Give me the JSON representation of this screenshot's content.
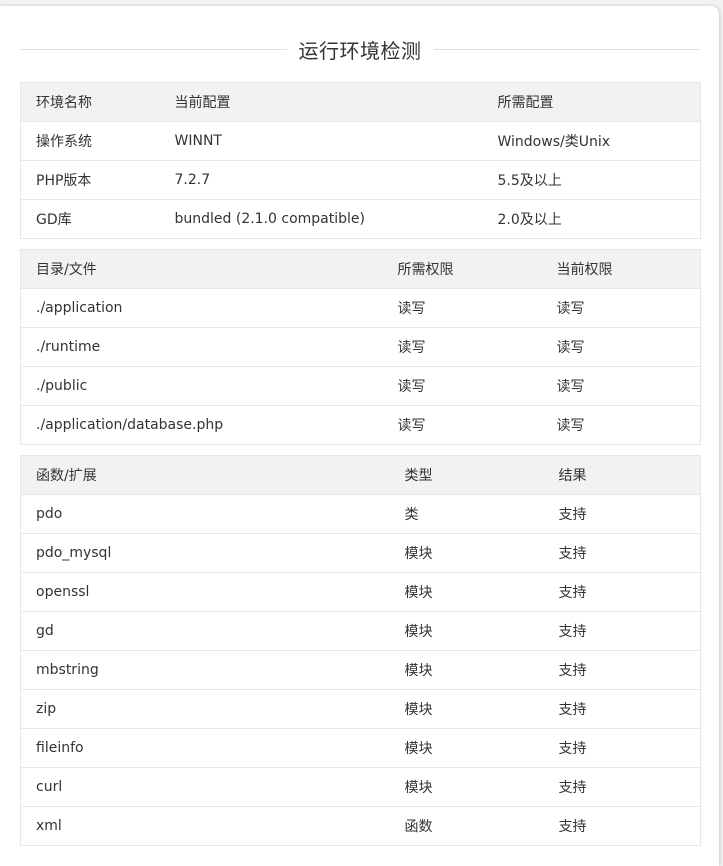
{
  "title": "运行环境检测",
  "env_table": {
    "headers": [
      "环境名称",
      "当前配置",
      "所需配置"
    ],
    "rows": [
      [
        "操作系统",
        "WINNT",
        "Windows/类Unix"
      ],
      [
        "PHP版本",
        "7.2.7",
        "5.5及以上"
      ],
      [
        "GD库",
        "bundled (2.1.0 compatible)",
        "2.0及以上"
      ]
    ]
  },
  "dir_table": {
    "headers": [
      "目录/文件",
      "所需权限",
      "当前权限"
    ],
    "rows": [
      [
        "./application",
        "读写",
        "读写"
      ],
      [
        "./runtime",
        "读写",
        "读写"
      ],
      [
        "./public",
        "读写",
        "读写"
      ],
      [
        "./application/database.php",
        "读写",
        "读写"
      ]
    ]
  },
  "func_table": {
    "headers": [
      "函数/扩展",
      "类型",
      "结果"
    ],
    "rows": [
      [
        "pdo",
        "类",
        "支持"
      ],
      [
        "pdo_mysql",
        "模块",
        "支持"
      ],
      [
        "openssl",
        "模块",
        "支持"
      ],
      [
        "gd",
        "模块",
        "支持"
      ],
      [
        "mbstring",
        "模块",
        "支持"
      ],
      [
        "zip",
        "模块",
        "支持"
      ],
      [
        "fileinfo",
        "模块",
        "支持"
      ],
      [
        "curl",
        "模块",
        "支持"
      ],
      [
        "xml",
        "函数",
        "支持"
      ]
    ]
  }
}
